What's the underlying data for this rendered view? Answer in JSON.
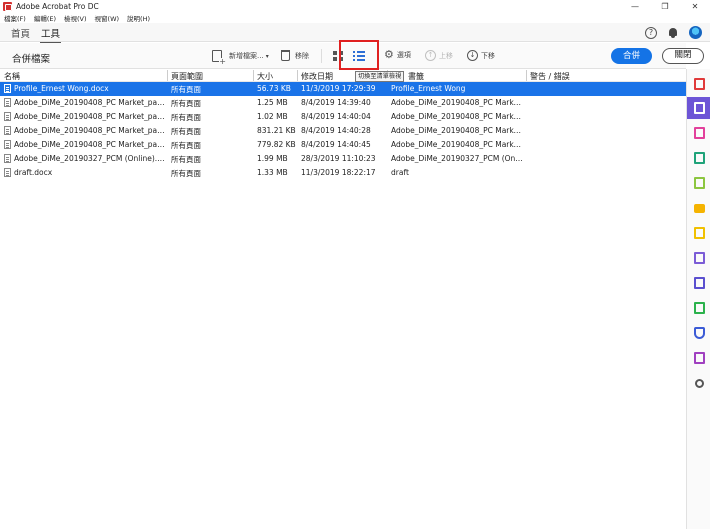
{
  "window": {
    "title": "Adobe Acrobat Pro DC",
    "controls": [
      "—",
      "❐",
      "✕"
    ]
  },
  "menu": [
    "檔案(F)",
    "編輯(E)",
    "檢視(V)",
    "視窗(W)",
    "說明(H)"
  ],
  "tabs": {
    "home": "首頁",
    "tools": "工具"
  },
  "toolbar": {
    "title": "合併檔案",
    "add_files": "新增檔案...",
    "remove": "移除",
    "options": "選項",
    "move_up": "上移",
    "move_down": "下移",
    "tooltip": "切換至清單檢視",
    "combine": "合併",
    "close": "關閉"
  },
  "table": {
    "headers": [
      "名稱",
      "頁面範圍",
      "大小",
      "修改日期",
      "書籤",
      "警告 / 錯誤"
    ],
    "rows": [
      {
        "name": "Profile_Ernest Wong.docx",
        "range": "所有頁面",
        "size": "56.73 KB",
        "date": "11/3/2019 17:29:39",
        "bookmark": "Profile_Ernest Wong",
        "selected": true
      },
      {
        "name": "Adobe_DiMe_20190408_PC Market_pag...",
        "range": "所有頁面",
        "size": "1.25 MB",
        "date": "8/4/2019 14:39:40",
        "bookmark": "Adobe_DiMe_20190408_PC Marke..."
      },
      {
        "name": "Adobe_DiMe_20190408_PC Market_pag...",
        "range": "所有頁面",
        "size": "1.02 MB",
        "date": "8/4/2019 14:40:04",
        "bookmark": "Adobe_DiMe_20190408_PC Marke..."
      },
      {
        "name": "Adobe_DiMe_20190408_PC Market_pag...",
        "range": "所有頁面",
        "size": "831.21 KB",
        "date": "8/4/2019 14:40:28",
        "bookmark": "Adobe_DiMe_20190408_PC Marke..."
      },
      {
        "name": "Adobe_DiMe_20190408_PC Market_pag...",
        "range": "所有頁面",
        "size": "779.82 KB",
        "date": "8/4/2019 14:40:45",
        "bookmark": "Adobe_DiMe_20190408_PC Marke..."
      },
      {
        "name": "Adobe_DiMe_20190327_PCM (Online).j...",
        "range": "所有頁面",
        "size": "1.99 MB",
        "date": "28/3/2019 11:10:23",
        "bookmark": "Adobe_DiMe_20190327_PCM (Onli..."
      },
      {
        "name": "draft.docx",
        "range": "所有頁面",
        "size": "1.33 MB",
        "date": "11/3/2019 18:22:17",
        "bookmark": "draft"
      }
    ]
  },
  "rail": [
    {
      "icon": "create-pdf-icon",
      "color": "#e03a3a"
    },
    {
      "icon": "combine-files-icon",
      "color": "#ffffff",
      "active": true
    },
    {
      "icon": "organize-pages-icon",
      "color": "#e2409b"
    },
    {
      "icon": "export-pdf-icon",
      "color": "#1fa37a"
    },
    {
      "icon": "edit-pdf-icon",
      "color": "#8cc63f"
    },
    {
      "icon": "comment-icon",
      "color": "#f5b300"
    },
    {
      "icon": "fill-sign-icon",
      "color": "#f0c000"
    },
    {
      "icon": "send-signature-icon",
      "color": "#7b5cd6"
    },
    {
      "icon": "stamp-icon",
      "color": "#5a4fcf"
    },
    {
      "icon": "print-production-icon",
      "color": "#2bb24c"
    },
    {
      "icon": "protect-icon",
      "color": "#3b5bd6"
    },
    {
      "icon": "more-tools-doc-icon",
      "color": "#a040c0"
    },
    {
      "icon": "customize-tools-icon",
      "color": "#555555"
    }
  ]
}
